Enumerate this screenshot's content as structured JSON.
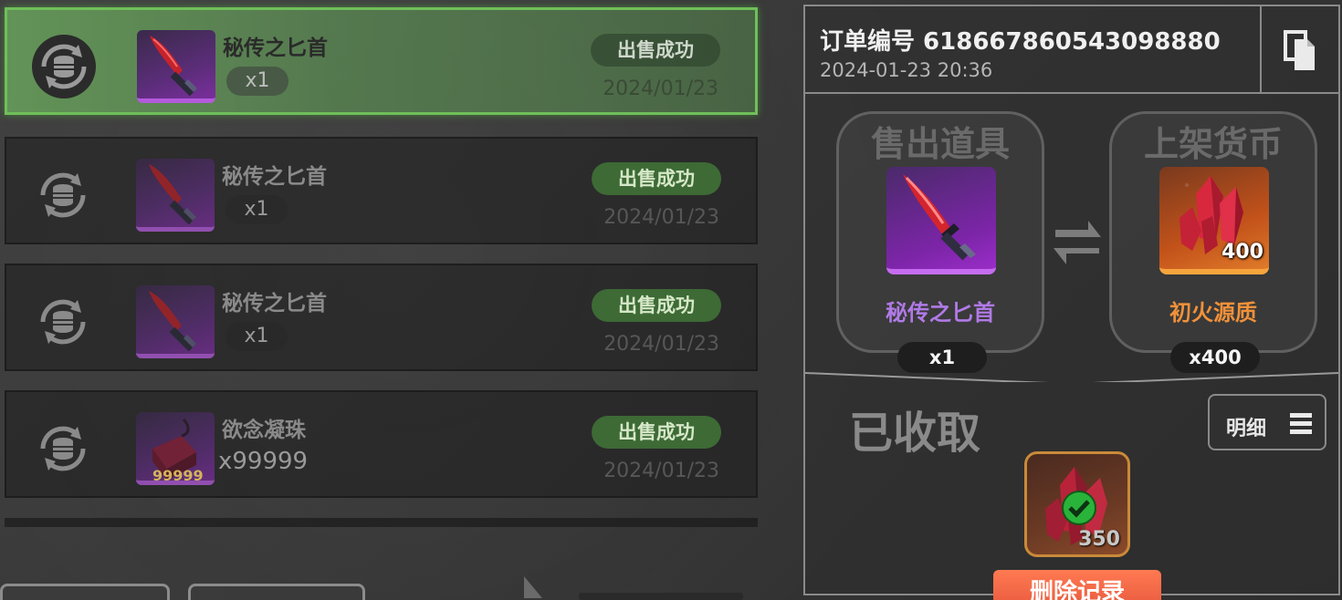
{
  "list": {
    "items": [
      {
        "name": "秘传之匕首",
        "qty": "x1",
        "status": "出售成功",
        "date": "2024/01/23",
        "selected": true
      },
      {
        "name": "秘传之匕首",
        "qty": "x1",
        "status": "出售成功",
        "date": "2024/01/23",
        "selected": false
      },
      {
        "name": "秘传之匕首",
        "qty": "x1",
        "status": "出售成功",
        "date": "2024/01/23",
        "selected": false
      },
      {
        "name": "欲念凝珠",
        "qty": "x99999",
        "badge": "99999",
        "status": "出售成功",
        "date": "2024/01/23",
        "selected": false
      }
    ]
  },
  "detail": {
    "order_label": "订单编号 618667860543098880",
    "order_time": "2024-01-23 20:36",
    "sold_item": {
      "title": "售出道具",
      "name": "秘传之匕首",
      "count": "x1"
    },
    "currency": {
      "title": "上架货币",
      "name": "初火源质",
      "count": "x400",
      "icon_qty": "400"
    },
    "collected_title": "已收取",
    "detail_button": "明细",
    "reward_qty": "350",
    "delete_button": "删除记录"
  },
  "colors": {
    "selected_row": "#6fbf5a",
    "status_green": "#3d6a35",
    "item_purple": "#b07ae6",
    "currency_orange": "#f0913a",
    "delete_red": "#ff6a45"
  }
}
